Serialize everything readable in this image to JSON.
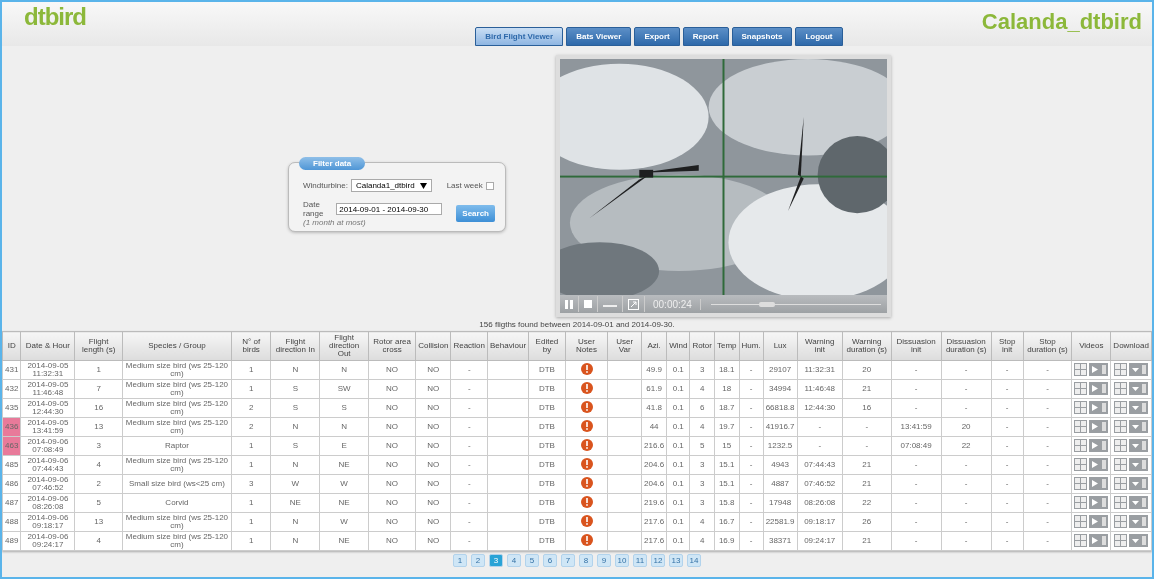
{
  "logo": "dtbird",
  "site_title": "Calanda_dtbird",
  "tabs": [
    {
      "label": "Bird Flight Viewer",
      "selected": true
    },
    {
      "label": "Bats Viewer",
      "selected": false
    },
    {
      "label": "Export",
      "selected": false
    },
    {
      "label": "Report",
      "selected": false
    },
    {
      "label": "Snapshots",
      "selected": false
    },
    {
      "label": "Logout",
      "selected": false
    }
  ],
  "filter": {
    "legend": "Filter data",
    "windturbine_label": "Windturbine:",
    "windturbine_value": "Calanda1_dtbird",
    "last_week_label": "Last week",
    "last_week_checked": false,
    "date_range_label": "Date range",
    "date_range_value": "2014-09-01 - 2014-09-30",
    "date_hint": "(1 month at most)",
    "search_button": "Search"
  },
  "player": {
    "time": "00:00:24",
    "level": 0.33
  },
  "caption": "156 fligths found between 2014-09-01 and 2014-09-30.",
  "columns": [
    {
      "label": "ID",
      "kind": "text"
    },
    {
      "label": "Date & Hour",
      "kind": "text"
    },
    {
      "label": "Flight length (s)",
      "kind": "text"
    },
    {
      "label": "Species / Group",
      "kind": "text"
    },
    {
      "label": "N° of birds",
      "kind": "text"
    },
    {
      "label": "Flight direction In",
      "kind": "text"
    },
    {
      "label": "Flight direction Out",
      "kind": "text"
    },
    {
      "label": "Rotor area cross",
      "kind": "text"
    },
    {
      "label": "Collision",
      "kind": "text"
    },
    {
      "label": "Reaction",
      "kind": "text"
    },
    {
      "label": "Behaviour",
      "kind": "blank"
    },
    {
      "label": "Edited by",
      "kind": "text"
    },
    {
      "label": "User Notes",
      "kind": "note"
    },
    {
      "label": "User Var",
      "kind": "blank"
    },
    {
      "label": "Azi.",
      "kind": "text"
    },
    {
      "label": "Wind",
      "kind": "text"
    },
    {
      "label": "Rotor",
      "kind": "text"
    },
    {
      "label": "Temp",
      "kind": "text"
    },
    {
      "label": "Hum.",
      "kind": "text"
    },
    {
      "label": "Lux",
      "kind": "text"
    },
    {
      "label": "Warning init",
      "kind": "text"
    },
    {
      "label": "Warning duration (s)",
      "kind": "text"
    },
    {
      "label": "Dissuasion init",
      "kind": "text"
    },
    {
      "label": "Dissuasion duration (s)",
      "kind": "text"
    },
    {
      "label": "Stop init",
      "kind": "text"
    },
    {
      "label": "Stop duration (s)",
      "kind": "text"
    },
    {
      "label": "Videos",
      "kind": "videos"
    },
    {
      "label": "Download",
      "kind": "download"
    }
  ],
  "rows": [
    {
      "highlighted": false,
      "cells": [
        "431",
        "2014-09-05 11:32:31",
        "1",
        "Medium size bird (ws 25-120 cm)",
        "1",
        "N",
        "N",
        "NO",
        "NO",
        "-",
        "DTB",
        "49.9",
        "0.1",
        "3",
        "18.1",
        "-",
        "29107",
        "11:32:31",
        "20",
        "-",
        "-",
        "-",
        "-"
      ]
    },
    {
      "highlighted": false,
      "cells": [
        "432",
        "2014-09-05 11:46:48",
        "7",
        "Medium size bird (ws 25-120 cm)",
        "1",
        "S",
        "SW",
        "NO",
        "NO",
        "-",
        "DTB",
        "61.9",
        "0.1",
        "4",
        "18",
        "-",
        "34994",
        "11:46:48",
        "21",
        "-",
        "-",
        "-",
        "-"
      ]
    },
    {
      "highlighted": false,
      "cells": [
        "435",
        "2014-09-05 12:44:30",
        "16",
        "Medium size bird (ws 25-120 cm)",
        "2",
        "S",
        "S",
        "NO",
        "NO",
        "-",
        "DTB",
        "41.8",
        "0.1",
        "6",
        "18.7",
        "-",
        "66818.8",
        "12:44:30",
        "16",
        "-",
        "-",
        "-",
        "-"
      ]
    },
    {
      "highlighted": true,
      "cells": [
        "436",
        "2014-09-05 13:41:59",
        "13",
        "Medium size bird (ws 25-120 cm)",
        "2",
        "N",
        "N",
        "NO",
        "NO",
        "-",
        "DTB",
        "44",
        "0.1",
        "4",
        "19.7",
        "-",
        "41916.7",
        "-",
        "-",
        "13:41:59",
        "20",
        "-",
        "-"
      ]
    },
    {
      "highlighted": true,
      "cells": [
        "463",
        "2014-09-06 07:08:49",
        "3",
        "Raptor",
        "1",
        "S",
        "E",
        "NO",
        "NO",
        "-",
        "DTB",
        "216.6",
        "0.1",
        "5",
        "15",
        "-",
        "1232.5",
        "-",
        "-",
        "07:08:49",
        "22",
        "-",
        "-"
      ]
    },
    {
      "highlighted": false,
      "cells": [
        "485",
        "2014-09-06 07:44:43",
        "4",
        "Medium size bird (ws 25-120 cm)",
        "1",
        "N",
        "NE",
        "NO",
        "NO",
        "-",
        "DTB",
        "204.6",
        "0.1",
        "3",
        "15.1",
        "-",
        "4943",
        "07:44:43",
        "21",
        "-",
        "-",
        "-",
        "-"
      ]
    },
    {
      "highlighted": false,
      "cells": [
        "486",
        "2014-09-06 07:46:52",
        "2",
        "Small size bird (ws<25 cm)",
        "3",
        "W",
        "W",
        "NO",
        "NO",
        "-",
        "DTB",
        "204.6",
        "0.1",
        "3",
        "15.1",
        "-",
        "4887",
        "07:46:52",
        "21",
        "-",
        "-",
        "-",
        "-"
      ]
    },
    {
      "highlighted": false,
      "cells": [
        "487",
        "2014-09-06 08:26:08",
        "5",
        "Corvid",
        "1",
        "NE",
        "NE",
        "NO",
        "NO",
        "-",
        "DTB",
        "219.6",
        "0.1",
        "3",
        "15.8",
        "-",
        "17948",
        "08:26:08",
        "22",
        "-",
        "-",
        "-",
        "-"
      ]
    },
    {
      "highlighted": false,
      "cells": [
        "488",
        "2014-09-06 09:18:17",
        "13",
        "Medium size bird (ws 25-120 cm)",
        "1",
        "N",
        "W",
        "NO",
        "NO",
        "-",
        "DTB",
        "217.6",
        "0.1",
        "4",
        "16.7",
        "-",
        "22581.9",
        "09:18:17",
        "26",
        "-",
        "-",
        "-",
        "-"
      ]
    },
    {
      "highlighted": false,
      "cells": [
        "489",
        "2014-09-06 09:24:17",
        "4",
        "Medium size bird (ws 25-120 cm)",
        "1",
        "N",
        "NE",
        "NO",
        "NO",
        "-",
        "DTB",
        "217.6",
        "0.1",
        "4",
        "16.9",
        "-",
        "38371",
        "09:24:17",
        "21",
        "-",
        "-",
        "-",
        "-"
      ]
    }
  ],
  "pages": [
    {
      "label": "1",
      "selected": false
    },
    {
      "label": "2",
      "selected": false
    },
    {
      "label": "3",
      "selected": true
    },
    {
      "label": "4",
      "selected": false
    },
    {
      "label": "5",
      "selected": false
    },
    {
      "label": "6",
      "selected": false
    },
    {
      "label": "7",
      "selected": false
    },
    {
      "label": "8",
      "selected": false
    },
    {
      "label": "9",
      "selected": false
    },
    {
      "label": "10",
      "selected": false
    },
    {
      "label": "11",
      "selected": false
    },
    {
      "label": "12",
      "selected": false
    },
    {
      "label": "13",
      "selected": false
    },
    {
      "label": "14",
      "selected": false
    }
  ]
}
